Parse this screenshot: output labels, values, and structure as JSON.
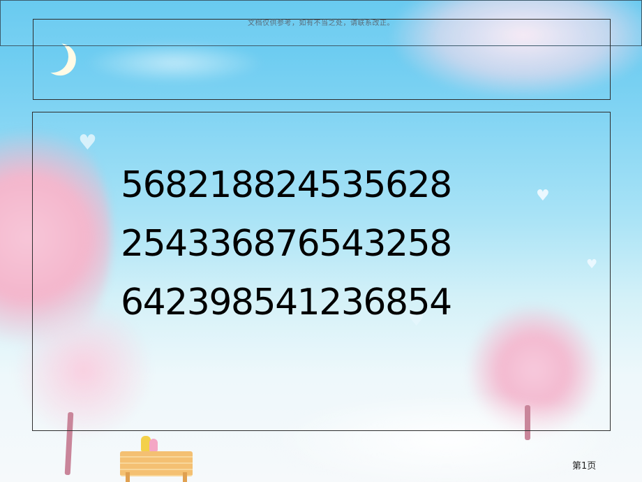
{
  "header": {
    "note": "文档仅供参考，如有不当之处，请联系改正。"
  },
  "main": {
    "lines": [
      "568218824535628",
      "254336876543258",
      "642398541236854"
    ]
  },
  "footer": {
    "page_label": "第1页"
  }
}
